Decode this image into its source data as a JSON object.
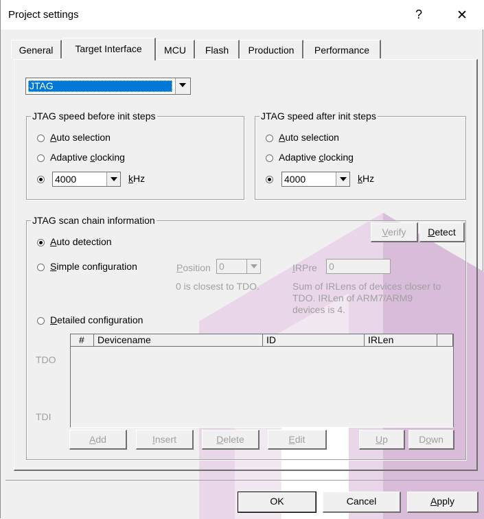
{
  "window": {
    "title": "Project settings",
    "help_btn": "?",
    "close_btn": "✕"
  },
  "tabs": [
    {
      "label": "General",
      "active": false
    },
    {
      "label": "Target Interface",
      "active": true
    },
    {
      "label": "MCU",
      "active": false
    },
    {
      "label": "Flash",
      "active": false
    },
    {
      "label": "Production",
      "active": false
    },
    {
      "label": "Performance",
      "active": false
    }
  ],
  "interface_select": {
    "value": "JTAG"
  },
  "speed_before": {
    "title": "JTAG speed before init steps",
    "auto": {
      "pre": "",
      "ul": "A",
      "post": "uto selection"
    },
    "adaptive": {
      "pre": "Adaptive ",
      "ul": "c",
      "post": "locking"
    },
    "speed_value": "4000",
    "unit": {
      "ul": "k",
      "post": "Hz"
    },
    "selected": "fixed"
  },
  "speed_after": {
    "title": "JTAG speed after init steps",
    "auto": {
      "pre": "",
      "ul": "A",
      "post": "uto selection"
    },
    "adaptive": {
      "pre": "Adaptive ",
      "ul": "c",
      "post": "locking"
    },
    "speed_value": "4000",
    "unit": {
      "ul": "k",
      "post": "Hz"
    },
    "selected": "fixed"
  },
  "scan_chain": {
    "title": "JTAG scan chain information",
    "verify_btn": {
      "ul": "V",
      "post": "erify"
    },
    "detect_btn": {
      "ul": "D",
      "post": "etect"
    },
    "auto_detection": {
      "ul": "A",
      "post": "uto detection"
    },
    "simple_config": {
      "ul": "S",
      "post": "imple configuration"
    },
    "position_label": {
      "ul": "P",
      "post": "osition"
    },
    "position_value": "0",
    "position_hint": "0 is closest to TDO.",
    "irpre_label": {
      "ul": "I",
      "post": "RPre"
    },
    "irpre_value": "0",
    "irpre_hint_1": "Sum of IRLens of devices closer to",
    "irpre_hint_2": "TDO. IRLen of ARM7/ARM9",
    "irpre_hint_3": "devices is 4.",
    "detailed_config": {
      "ul": "D",
      "post": "etailed configuration"
    },
    "tdo_label": "TDO",
    "tdi_label": "TDI",
    "table_columns": [
      "#",
      "Devicename",
      "ID",
      "IRLen"
    ],
    "buttons": {
      "add": {
        "ul": "A",
        "post": "dd"
      },
      "insert": {
        "ul": "I",
        "post": "nsert"
      },
      "delete": {
        "ul": "D",
        "post": "elete"
      },
      "edit": {
        "ul": "E",
        "post": "dit"
      },
      "up": {
        "ul": "U",
        "post": "p"
      },
      "down": {
        "pre": "D",
        "ul": "o",
        "post": "wn"
      }
    },
    "selected": "auto"
  },
  "footer": {
    "ok": "OK",
    "cancel": "Cancel",
    "apply": {
      "ul": "A",
      "post": "pply"
    }
  },
  "colors": {
    "watermark": "#e8d4e8",
    "selection": "#0078d7",
    "disabled_text": "#a0a0a0"
  }
}
